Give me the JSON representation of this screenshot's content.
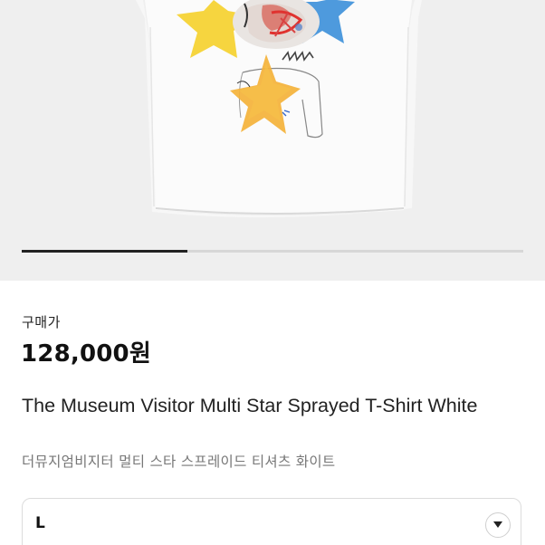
{
  "product": {
    "price_label": "구매가",
    "price": "128,000원",
    "title": "The Museum Visitor Multi Star Sprayed T-Shirt White",
    "subtitle": "더뮤지엄비지터 멀티 스타 스프레이드 티셔츠 화이트"
  },
  "gallery": {
    "image_name": "product-image",
    "progress": 0.33
  },
  "size_select": {
    "selected": "L",
    "icon": "chevron-down-icon"
  },
  "colors": {
    "hero_background": "#efefef",
    "progress_active": "#222222",
    "progress_track": "#d7d7d7"
  }
}
